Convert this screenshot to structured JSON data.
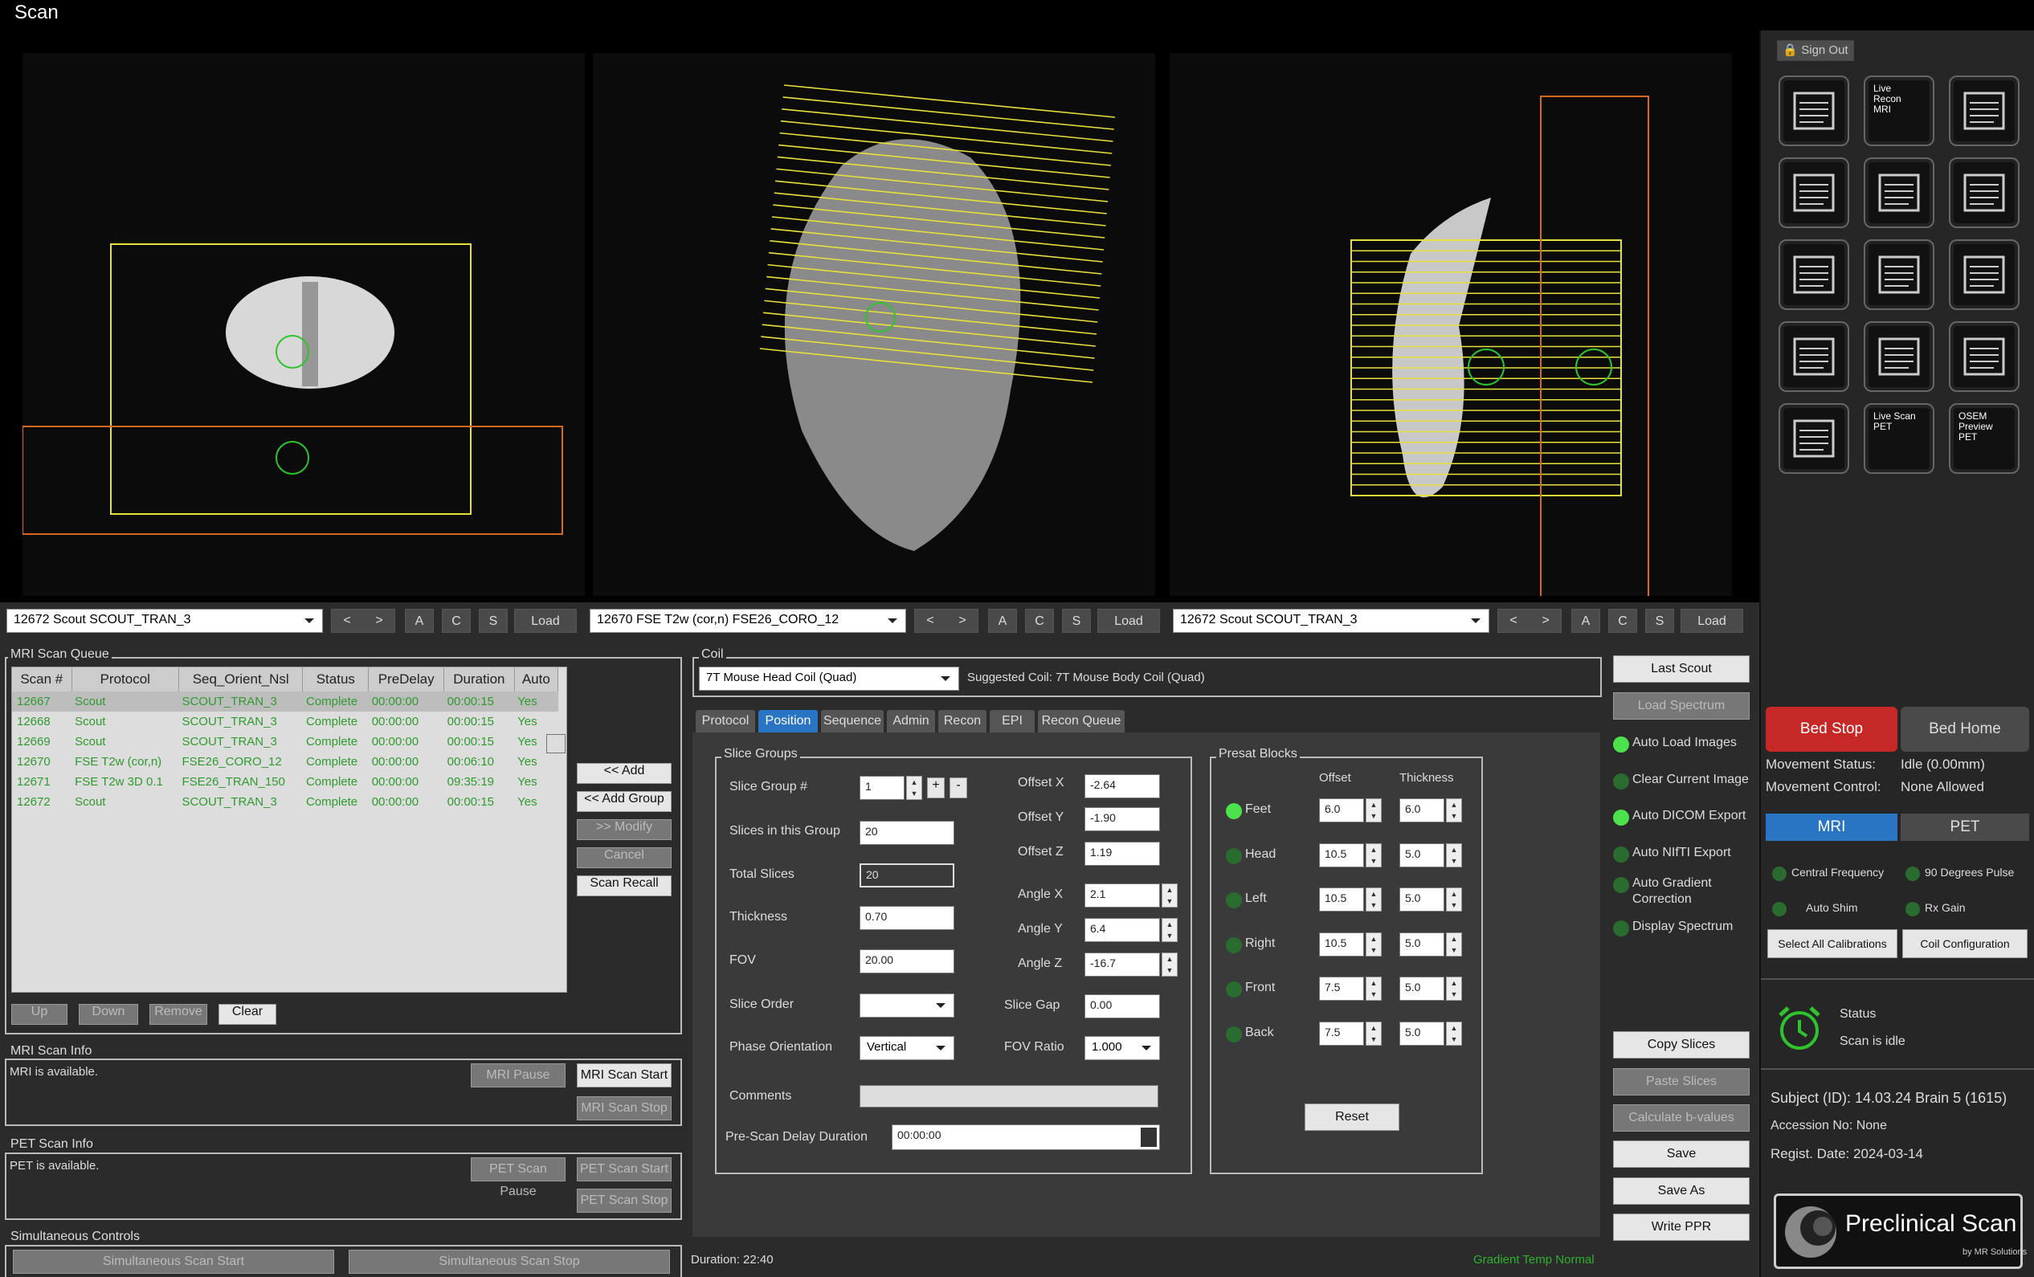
{
  "window": {
    "title": "Scan"
  },
  "viewports": [
    {
      "series": "12672  Scout SCOUT_TRAN_3",
      "prev": "<",
      "next": ">",
      "a": "A",
      "c": "C",
      "s": "S",
      "load": "Load"
    },
    {
      "series": "12670 FSE T2w (cor,n) FSE26_CORO_12",
      "prev": "<",
      "next": ">",
      "a": "A",
      "c": "C",
      "s": "S",
      "load": "Load"
    },
    {
      "series": "12672  Scout SCOUT_TRAN_3",
      "prev": "<",
      "next": ">",
      "a": "A",
      "c": "C",
      "s": "S",
      "load": "Load"
    }
  ],
  "queue": {
    "title": "MRI Scan Queue",
    "columns": [
      "Scan #",
      "Protocol",
      "Seq_Orient_Nsl",
      "Status",
      "PreDelay",
      "Duration",
      "Auto"
    ],
    "rows": [
      [
        "12667",
        "Scout",
        "SCOUT_TRAN_3",
        "Complete",
        "00:00:00",
        "00:00:15",
        "Yes"
      ],
      [
        "12668",
        "Scout",
        "SCOUT_TRAN_3",
        "Complete",
        "00:00:00",
        "00:00:15",
        "Yes"
      ],
      [
        "12669",
        "Scout",
        "SCOUT_TRAN_3",
        "Complete",
        "00:00:00",
        "00:00:15",
        "Yes"
      ],
      [
        "12670",
        "FSE T2w (cor,n)",
        "FSE26_CORO_12",
        "Complete",
        "00:00:00",
        "00:06:10",
        "Yes"
      ],
      [
        "12671",
        "FSE T2w 3D 0.1",
        "FSE26_TRAN_150",
        "Complete",
        "00:00:00",
        "09:35:19",
        "Yes"
      ],
      [
        "12672",
        "Scout",
        "SCOUT_TRAN_3",
        "Complete",
        "00:00:00",
        "00:00:15",
        "Yes"
      ]
    ],
    "add": "<< Add",
    "add_group": "<< Add Group",
    "modify": ">> Modify",
    "cancel": "Cancel",
    "recall": "Scan Recall",
    "up": "Up",
    "down": "Down",
    "remove": "Remove",
    "clear": "Clear"
  },
  "mri_info": {
    "title": "MRI Scan Info",
    "status": "MRI is available.",
    "pause": "MRI Pause",
    "start": "MRI Scan Start",
    "stop": "MRI Scan Stop"
  },
  "pet_info": {
    "title": "PET Scan Info",
    "status": "PET is available.",
    "pause": "PET Scan Pause",
    "start": "PET Scan Start",
    "stop": "PET Scan Stop"
  },
  "simul": {
    "title": "Simultaneous Controls",
    "start": "Simultaneous Scan Start",
    "stop": "Simultaneous Scan Stop"
  },
  "coil": {
    "title": "Coil",
    "value": "7T Mouse Head Coil (Quad)",
    "suggested": "Suggested Coil: 7T Mouse Body Coil (Quad)"
  },
  "tabs": [
    "Protocol",
    "Position",
    "Sequence",
    "Admin",
    "Recon",
    "EPI",
    "Recon Queue"
  ],
  "slice_groups": {
    "title": "Slice Groups",
    "group_label": "Slice Group #",
    "group_value": "1",
    "plus": "+",
    "minus": "-",
    "slices_label": "Slices in this Group",
    "slices_value": "20",
    "total_label": "Total Slices",
    "total_value": "20",
    "thick_label": "Thickness",
    "thick_value": "0.70",
    "fov_label": "FOV",
    "fov_value": "20.00",
    "order_label": "Slice Order",
    "order_value": "",
    "phase_label": "Phase Orientation",
    "phase_value": "Vertical",
    "offx_label": "Offset X",
    "offx": "-2.64",
    "offy_label": "Offset Y",
    "offy": "-1.90",
    "offz_label": "Offset Z",
    "offz": "1.19",
    "angx_label": "Angle X",
    "angx": "2.1",
    "angy_label": "Angle Y",
    "angy": "6.4",
    "angz_label": "Angle Z",
    "angz": "-16.7",
    "gap_label": "Slice Gap",
    "gap": "0.00",
    "ratio_label": "FOV Ratio",
    "ratio": "1.000",
    "comments_label": "Comments",
    "comments": "",
    "delay_label": "Pre-Scan Delay Duration",
    "delay": "00:00:00"
  },
  "presat": {
    "title": "Presat Blocks",
    "offset_h": "Offset",
    "thick_h": "Thickness",
    "reset": "Reset",
    "rows": [
      {
        "name": "Feet",
        "offset": "6.0",
        "thick": "6.0",
        "on": true
      },
      {
        "name": "Head",
        "offset": "10.5",
        "thick": "5.0",
        "on": false
      },
      {
        "name": "Left",
        "offset": "10.5",
        "thick": "5.0",
        "on": false
      },
      {
        "name": "Right",
        "offset": "10.5",
        "thick": "5.0",
        "on": false
      },
      {
        "name": "Front",
        "offset": "7.5",
        "thick": "5.0",
        "on": false
      },
      {
        "name": "Back",
        "offset": "7.5",
        "thick": "5.0",
        "on": false
      }
    ]
  },
  "duration": "Duration: 22:40",
  "gradient_temp": "Gradient Temp Normal",
  "right_col": {
    "last_scout": "Last Scout",
    "load_spectrum": "Load Spectrum",
    "options": [
      {
        "label": "Auto Load Images",
        "on": true
      },
      {
        "label": "Clear Current Image",
        "on": false
      },
      {
        "label": "Auto DICOM Export",
        "on": true
      },
      {
        "label": "Auto NIfTI Export",
        "on": false
      },
      {
        "label": "Auto Gradient Correction",
        "on": false
      },
      {
        "label": "Display Spectrum",
        "on": false
      }
    ],
    "copy": "Copy Slices",
    "paste": "Paste Slices",
    "calc": "Calculate b-values",
    "save": "Save",
    "save_as": "Save As",
    "write": "Write PPR"
  },
  "side": {
    "sign_out": "Sign Out",
    "bed_stop": "Bed Stop",
    "bed_home": "Bed Home",
    "move_status_label": "Movement Status:",
    "move_status": "Idle (0.00mm)",
    "move_ctrl_label": "Movement Control:",
    "move_ctrl": "None Allowed",
    "mri": "MRI",
    "pet": "PET",
    "cal": [
      "Central Frequency",
      "90 Degrees Pulse",
      "Auto Shim",
      "Rx Gain"
    ],
    "select_cal": "Select All Calibrations",
    "coil_cfg": "Coil Configuration",
    "status_label": "Status",
    "status": "Scan is idle",
    "subject": "Subject (ID):  14.03.24 Brain 5 (1615)",
    "accession": "Accession No: None",
    "regist": "Regist. Date:  2024-03-14",
    "logo": "Preclinical Scan",
    "logo_sub": "by MR Solutions",
    "icon_text": [
      "Live Recon MRI",
      "Live Scan PET",
      "OSEM Preview PET"
    ]
  },
  "colors": {
    "accent": "#2a74c4",
    "green": "#4ce24c",
    "red": "#c62828",
    "yellow": "#e8e03a"
  }
}
